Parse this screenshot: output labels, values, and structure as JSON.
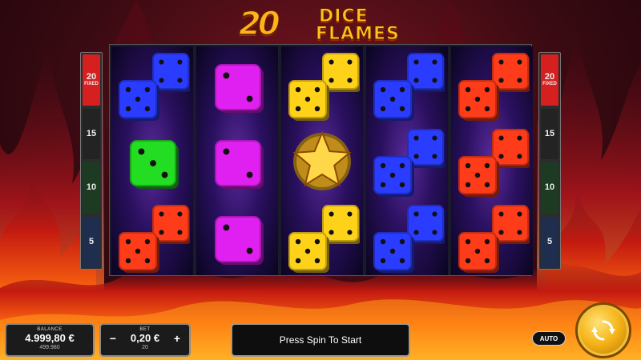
{
  "game": {
    "logo_number": "20",
    "logo_line1": "DICE",
    "logo_line2": "FLAMES"
  },
  "paylines": {
    "left": [
      {
        "value": "20",
        "tag": "FIXED",
        "color": "#d62020"
      },
      {
        "value": "15",
        "tag": "",
        "color": "#232323"
      },
      {
        "value": "10",
        "tag": "",
        "color": "#1d3b23"
      },
      {
        "value": "5",
        "tag": "",
        "color": "#1f2d4e"
      }
    ],
    "right": [
      {
        "value": "20",
        "tag": "FIXED",
        "color": "#d62020"
      },
      {
        "value": "15",
        "tag": "",
        "color": "#232323"
      },
      {
        "value": "10",
        "tag": "",
        "color": "#1d3b23"
      },
      {
        "value": "5",
        "tag": "",
        "color": "#1f2d4e"
      }
    ]
  },
  "reels": [
    [
      "double-dice-blue",
      "single-die-green",
      "double-dice-red"
    ],
    [
      "single-die-magenta",
      "single-die-magenta",
      "single-die-magenta"
    ],
    [
      "double-dice-yellow",
      "star-scatter",
      "double-dice-yellow"
    ],
    [
      "double-dice-blue",
      "double-dice-blue",
      "double-dice-blue"
    ],
    [
      "double-dice-red",
      "double-dice-red",
      "double-dice-red"
    ]
  ],
  "symbol_colors": {
    "blue": "#2a3cff",
    "green": "#22dd22",
    "red": "#ff3c1a",
    "magenta": "#e020f0",
    "yellow": "#ffd21a",
    "star": "#f0b020"
  },
  "balance": {
    "caption": "BALANCE",
    "amount": "4.999,80 €",
    "credits": "499.980"
  },
  "bet": {
    "caption": "BET",
    "minus": "−",
    "amount": "0,20 €",
    "plus": "+",
    "credits": "20"
  },
  "message": "Press Spin To Start",
  "auto_label": "AUTO",
  "spin_icon": "refresh-arrows-icon"
}
